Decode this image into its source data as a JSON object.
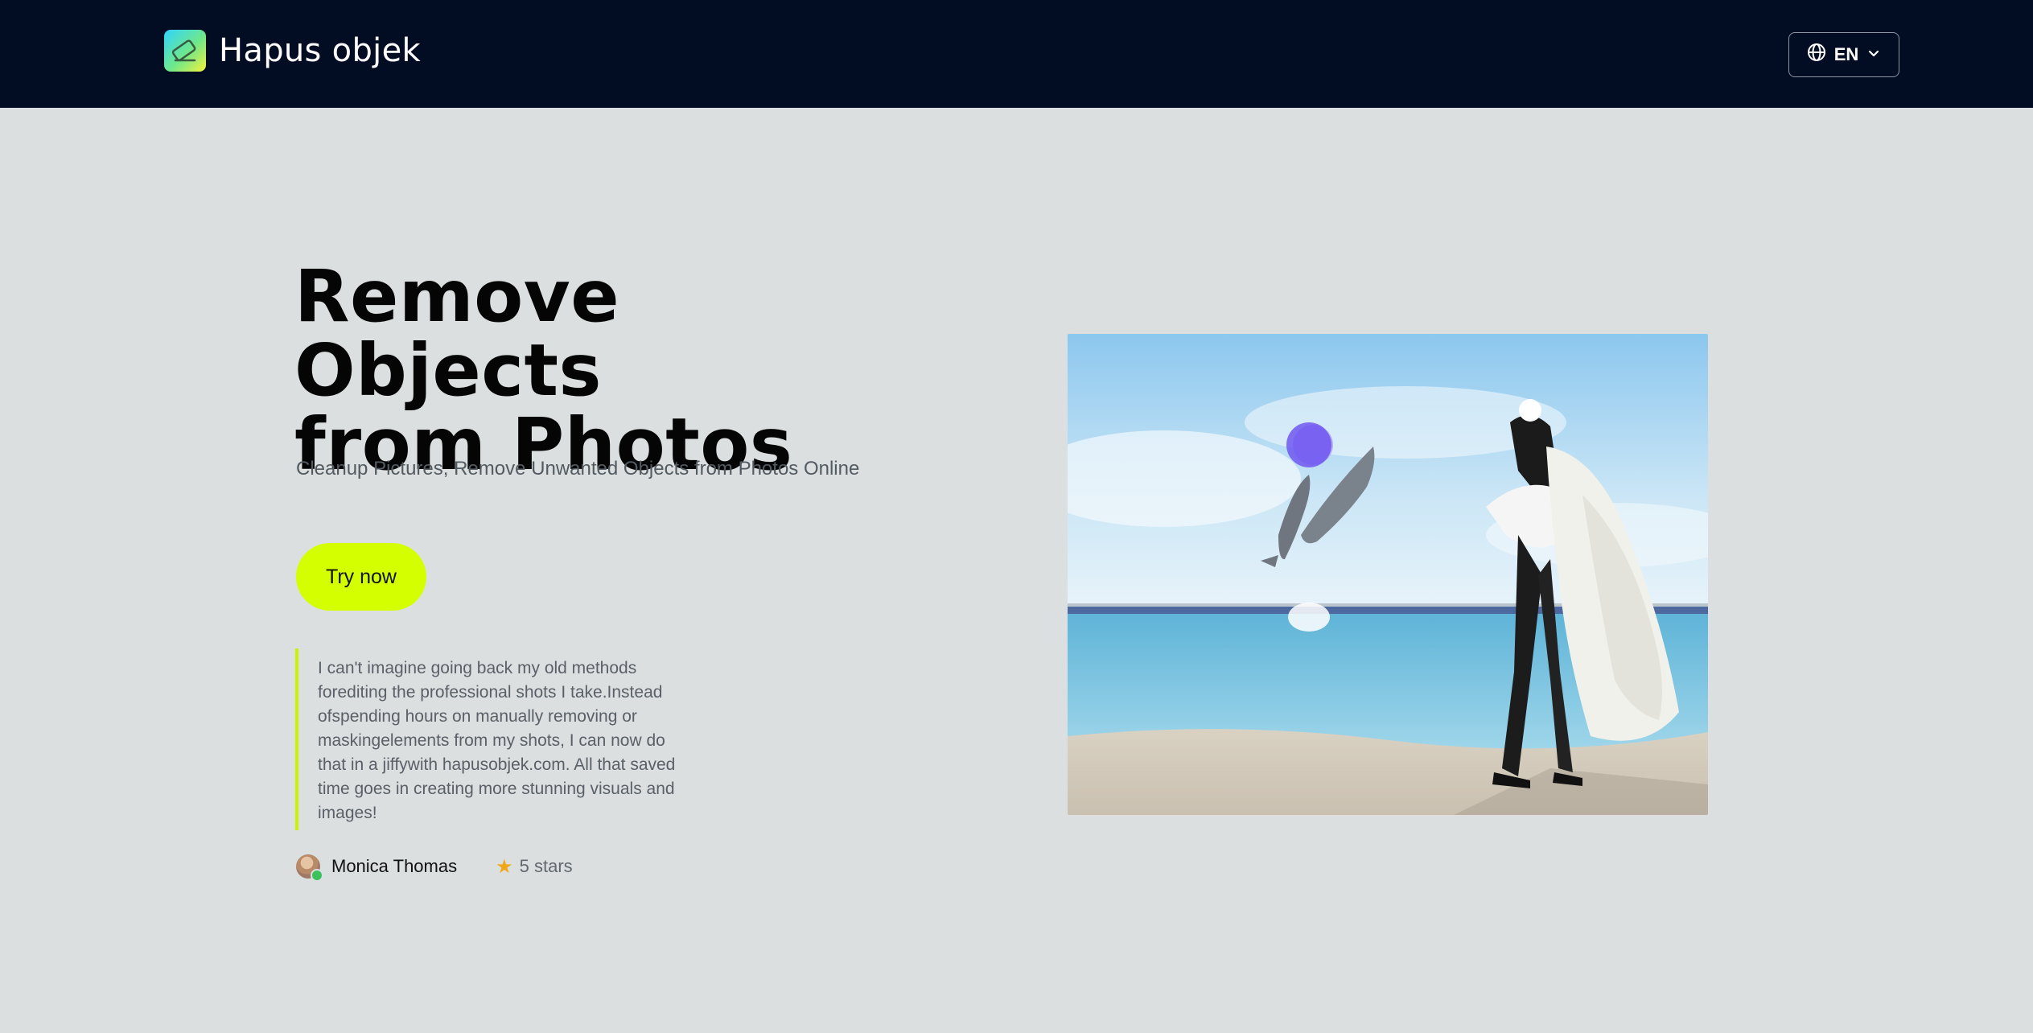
{
  "header": {
    "brand_name": "Hapus objek",
    "language": "EN"
  },
  "hero": {
    "title_line1": "Remove Objects",
    "title_line2": "from Photos",
    "subtitle": "Cleanup Pictures, Remove Unwanted Objects from Photos Online",
    "cta_label": "Try now"
  },
  "testimonial": {
    "quote": "I can't imagine going back my old methods forediting the professional shots I take.Instead ofspending hours on manually removing or maskingelements from my shots, I can now do that in a jiffywith hapusobjek.com. All that saved time goes in creating more stunning visuals and images!",
    "author": "Monica Thomas",
    "rating": "5 stars"
  },
  "colors": {
    "header_bg": "#020c23",
    "page_bg": "#dbdfdf",
    "accent": "#d4ff00"
  },
  "icons": {
    "logo": "eraser-logo-icon",
    "language": "globe-icon",
    "dropdown": "chevron-down-icon",
    "rating": "star-icon",
    "verified": "verified-badge-icon"
  }
}
